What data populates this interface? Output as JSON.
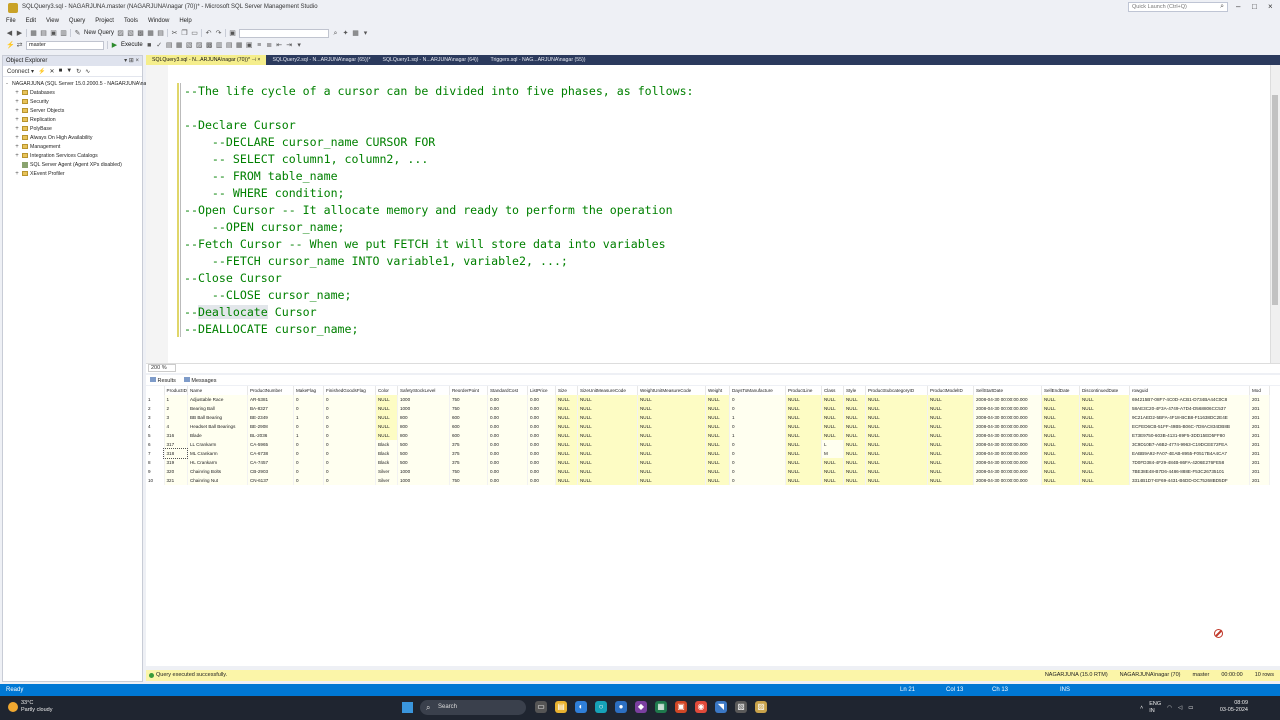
{
  "window": {
    "title": "SQLQuery3.sql - NAGARJUNA.master (NAGARJUNA\\nagar (70))* - Microsoft SQL Server Management Studio",
    "quick_launch_placeholder": "Quick Launch (Ctrl+Q)"
  },
  "menu": [
    "File",
    "Edit",
    "View",
    "Query",
    "Project",
    "Tools",
    "Window",
    "Help"
  ],
  "toolbar": {
    "new_query": "New Query",
    "database": "master",
    "execute": "Execute"
  },
  "object_explorer": {
    "title": "Object Explorer",
    "connect": "Connect",
    "tree": [
      {
        "label": "NAGARJUNA (SQL Server 15.0.2000.5 - NAGARJUNA\\nagar)",
        "level": 0,
        "icon": "server",
        "expand": "-"
      },
      {
        "label": "Databases",
        "level": 1,
        "icon": "folder",
        "expand": "+"
      },
      {
        "label": "Security",
        "level": 1,
        "icon": "folder",
        "expand": "+"
      },
      {
        "label": "Server Objects",
        "level": 1,
        "icon": "folder",
        "expand": "+"
      },
      {
        "label": "Replication",
        "level": 1,
        "icon": "folder",
        "expand": "+"
      },
      {
        "label": "PolyBase",
        "level": 1,
        "icon": "folder",
        "expand": "+"
      },
      {
        "label": "Always On High Availability",
        "level": 1,
        "icon": "folder",
        "expand": "+"
      },
      {
        "label": "Management",
        "level": 1,
        "icon": "folder",
        "expand": "+"
      },
      {
        "label": "Integration Services Catalogs",
        "level": 1,
        "icon": "folder",
        "expand": "+"
      },
      {
        "label": "SQL Server Agent (Agent XPs disabled)",
        "level": 1,
        "icon": "agent",
        "expand": ""
      },
      {
        "label": "XEvent Profiler",
        "level": 1,
        "icon": "folder",
        "expand": "+"
      }
    ]
  },
  "tabs": [
    {
      "label": "SQLQuery3.sql - N...ARJUNA\\nagar (70))*",
      "active": true
    },
    {
      "label": "SQLQuery2.sql - N...ARJUNA\\nagar (65))*",
      "active": false
    },
    {
      "label": "SQLQuery1.sql - N...ARJUNA\\nagar (64))",
      "active": false
    },
    {
      "label": "Triggers.sql - NAG...ARJUNA\\nagar (55))",
      "active": false
    }
  ],
  "code_lines": [
    "--The life cycle of a cursor can be divided into five phases, as follows:",
    "",
    "--Declare Cursor",
    "    --DECLARE cursor_name CURSOR FOR",
    "    -- SELECT column1, column2, ...",
    "    -- FROM table_name",
    "    -- WHERE condition;",
    "--Open Cursor -- It allocate memory and ready to perform the operation",
    "    --OPEN cursor_name;",
    "--Fetch Cursor -- When we put FETCH it will store data into variables",
    "    --FETCH cursor_name INTO variable1, variable2, ...;",
    "--Close Cursor",
    "    --CLOSE cursor_name;",
    "--Deallocate Cursor",
    "--DEALLOCATE cursor_name;"
  ],
  "zoom": "200 %",
  "results_tabs": {
    "results": "Results",
    "messages": "Messages"
  },
  "grid": {
    "columns": [
      "ProductID",
      "Name",
      "ProductNumber",
      "MakeFlag",
      "FinishedGoodsFlag",
      "Color",
      "SafetyStockLevel",
      "ReorderPoint",
      "StandardCost",
      "ListPrice",
      "Size",
      "SizeUnitMeasureCode",
      "WeightUnitMeasureCode",
      "Weight",
      "DaysToManufacture",
      "ProductLine",
      "Class",
      "Style",
      "ProductSubcategoryID",
      "ProductModelID",
      "SellStartDate",
      "SellEndDate",
      "DiscontinuedDate",
      "rowguid",
      "Mod"
    ],
    "rows": [
      [
        "1",
        "Adjustable Race",
        "AR-5381",
        "0",
        "0",
        "NULL",
        "1000",
        "750",
        "0.00",
        "0.00",
        "NULL",
        "NULL",
        "NULL",
        "NULL",
        "0",
        "NULL",
        "NULL",
        "NULL",
        "NULL",
        "NULL",
        "2008-04-30 00:00:00.000",
        "NULL",
        "NULL",
        "694215B7-08F7-4C0D-ACB1-D734BA44C0C8",
        "201"
      ],
      [
        "2",
        "Bearing Ball",
        "BA-8327",
        "0",
        "0",
        "NULL",
        "1000",
        "750",
        "0.00",
        "0.00",
        "NULL",
        "NULL",
        "NULL",
        "NULL",
        "0",
        "NULL",
        "NULL",
        "NULL",
        "NULL",
        "NULL",
        "2008-04-30 00:00:00.000",
        "NULL",
        "NULL",
        "58AE3C20-4F3A-4749-A7D4-D568806CC537",
        "201"
      ],
      [
        "3",
        "BB Ball Bearing",
        "BE-2349",
        "1",
        "0",
        "NULL",
        "800",
        "600",
        "0.00",
        "0.00",
        "NULL",
        "NULL",
        "NULL",
        "NULL",
        "1",
        "NULL",
        "NULL",
        "NULL",
        "NULL",
        "NULL",
        "2008-04-30 00:00:00.000",
        "NULL",
        "NULL",
        "9C21AED2-5BFA-4F18-BCB8-F11638DC2E4E",
        "201"
      ],
      [
        "4",
        "Headset Ball Bearings",
        "BE-2908",
        "0",
        "0",
        "NULL",
        "800",
        "600",
        "0.00",
        "0.00",
        "NULL",
        "NULL",
        "NULL",
        "NULL",
        "0",
        "NULL",
        "NULL",
        "NULL",
        "NULL",
        "NULL",
        "2008-04-30 00:00:00.000",
        "NULL",
        "NULL",
        "ECFED6CB-51FF-49B5-B06C-7D8AC834DB8B",
        "201"
      ],
      [
        "316",
        "Blade",
        "BL-2036",
        "1",
        "0",
        "NULL",
        "800",
        "600",
        "0.00",
        "0.00",
        "NULL",
        "NULL",
        "NULL",
        "NULL",
        "1",
        "NULL",
        "NULL",
        "NULL",
        "NULL",
        "NULL",
        "2008-04-30 00:00:00.000",
        "NULL",
        "NULL",
        "E73E9750-603B-4131-89F5-3DD15ED5FF80",
        "201"
      ],
      [
        "317",
        "LL Crankarm",
        "CA-5965",
        "0",
        "0",
        "Black",
        "500",
        "375",
        "0.00",
        "0.00",
        "NULL",
        "NULL",
        "NULL",
        "NULL",
        "0",
        "NULL",
        "L",
        "NULL",
        "NULL",
        "NULL",
        "2008-04-30 00:00:00.000",
        "NULL",
        "NULL",
        "3C9D10B7-A6B2-4774-9963-C19DCEE72FEA",
        "201"
      ],
      [
        "318",
        "ML Crankarm",
        "CA-6738",
        "0",
        "0",
        "Black",
        "500",
        "375",
        "0.00",
        "0.00",
        "NULL",
        "NULL",
        "NULL",
        "NULL",
        "0",
        "NULL",
        "M",
        "NULL",
        "NULL",
        "NULL",
        "2008-04-30 00:00:00.000",
        "NULL",
        "NULL",
        "EABB9A92-FA07-4EAB-8955-F0517B4A4CA7",
        "201"
      ],
      [
        "319",
        "HL Crankarm",
        "CA-7457",
        "0",
        "0",
        "Black",
        "500",
        "375",
        "0.00",
        "0.00",
        "NULL",
        "NULL",
        "NULL",
        "NULL",
        "0",
        "NULL",
        "NULL",
        "NULL",
        "NULL",
        "NULL",
        "2008-04-30 00:00:00.000",
        "NULL",
        "NULL",
        "7D0FD384-4F29-484B-86FA-4206E276FE58",
        "201"
      ],
      [
        "320",
        "Chainring Bolts",
        "CB-2903",
        "0",
        "0",
        "Silver",
        "1000",
        "750",
        "0.00",
        "0.00",
        "NULL",
        "NULL",
        "NULL",
        "NULL",
        "0",
        "NULL",
        "NULL",
        "NULL",
        "NULL",
        "NULL",
        "2008-04-30 00:00:00.000",
        "NULL",
        "NULL",
        "7BE38E48-B7D6-4486-888E-F53C26735101",
        "201"
      ],
      [
        "321",
        "Chainring Nut",
        "CN-6137",
        "0",
        "0",
        "Silver",
        "1000",
        "750",
        "0.00",
        "0.00",
        "NULL",
        "NULL",
        "NULL",
        "NULL",
        "0",
        "NULL",
        "NULL",
        "NULL",
        "NULL",
        "NULL",
        "2008-04-30 00:00:00.000",
        "NULL",
        "NULL",
        "3314B1D7-EF69-4431-B6DD-DC75268BD5DF",
        "201"
      ]
    ]
  },
  "query_status": {
    "message": "Query executed successfully.",
    "server": "NAGARJUNA (15.0 RTM)",
    "user": "NAGARJUNA\\nagar (70)",
    "database": "master",
    "time": "00:00:00",
    "rows": "10 rows"
  },
  "statusbar": {
    "ready": "Ready",
    "ln": "Ln 21",
    "col": "Col 13",
    "ch": "Ch 13",
    "ins": "INS"
  },
  "taskbar": {
    "temp": "33°C",
    "weather": "Partly cloudy",
    "search": "Search",
    "lang1": "ENG",
    "lang2": "IN",
    "time": "08:09",
    "date": "03-05-2024"
  },
  "colors": {
    "accent": "#0078d4",
    "tab_active": "#f5ee8c",
    "comment": "#008000",
    "status_yellow": "#fbf5a8"
  }
}
